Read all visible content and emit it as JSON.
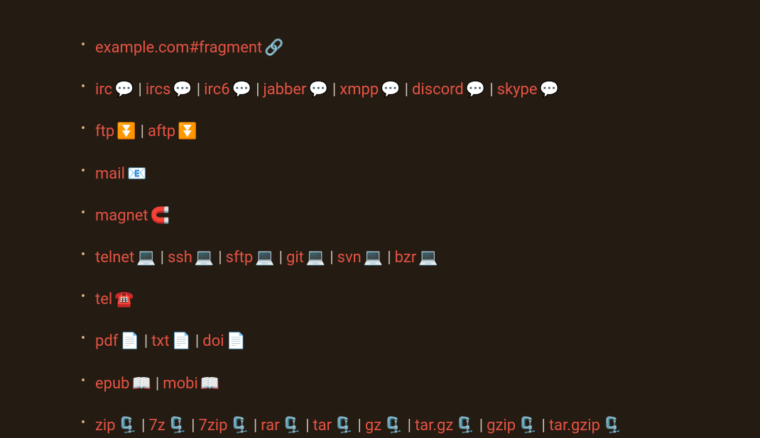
{
  "sep": "|",
  "items": [
    {
      "entries": [
        {
          "label": "example.com#fragment",
          "icon": "🔗",
          "name": "link-fragment"
        }
      ]
    },
    {
      "entries": [
        {
          "label": "irc",
          "icon": "💬",
          "name": "link-irc"
        },
        {
          "label": "ircs",
          "icon": "💬",
          "name": "link-ircs"
        },
        {
          "label": "irc6",
          "icon": "💬",
          "name": "link-irc6"
        },
        {
          "label": "jabber",
          "icon": "💬",
          "name": "link-jabber"
        },
        {
          "label": "xmpp",
          "icon": "💬",
          "name": "link-xmpp"
        },
        {
          "label": "discord",
          "icon": "💬",
          "name": "link-discord"
        },
        {
          "label": "skype",
          "icon": "💬",
          "name": "link-skype"
        }
      ]
    },
    {
      "entries": [
        {
          "label": "ftp",
          "icon": "⏬",
          "name": "link-ftp"
        },
        {
          "label": "aftp",
          "icon": "⏬",
          "name": "link-aftp"
        }
      ]
    },
    {
      "entries": [
        {
          "label": "mail",
          "icon": "📧",
          "name": "link-mail"
        }
      ]
    },
    {
      "entries": [
        {
          "label": "magnet",
          "icon": "🧲",
          "name": "link-magnet"
        }
      ]
    },
    {
      "entries": [
        {
          "label": "telnet",
          "icon": "💻",
          "name": "link-telnet"
        },
        {
          "label": "ssh",
          "icon": "💻",
          "name": "link-ssh"
        },
        {
          "label": "sftp",
          "icon": "💻",
          "name": "link-sftp"
        },
        {
          "label": "git",
          "icon": "💻",
          "name": "link-git"
        },
        {
          "label": "svn",
          "icon": "💻",
          "name": "link-svn"
        },
        {
          "label": "bzr",
          "icon": "💻",
          "name": "link-bzr"
        }
      ]
    },
    {
      "entries": [
        {
          "label": "tel",
          "icon": "☎️",
          "name": "link-tel"
        }
      ]
    },
    {
      "entries": [
        {
          "label": "pdf",
          "icon": "📄",
          "name": "link-pdf"
        },
        {
          "label": "txt",
          "icon": "📄",
          "name": "link-txt"
        },
        {
          "label": "doi",
          "icon": "📄",
          "name": "link-doi"
        }
      ]
    },
    {
      "entries": [
        {
          "label": "epub",
          "icon": "📖",
          "name": "link-epub"
        },
        {
          "label": "mobi",
          "icon": "📖",
          "name": "link-mobi"
        }
      ]
    },
    {
      "entries": [
        {
          "label": "zip",
          "icon": "🗜️",
          "name": "link-zip"
        },
        {
          "label": "7z",
          "icon": "🗜️",
          "name": "link-7z"
        },
        {
          "label": "7zip",
          "icon": "🗜️",
          "name": "link-7zip"
        },
        {
          "label": "rar",
          "icon": "🗜️",
          "name": "link-rar"
        },
        {
          "label": "tar",
          "icon": "🗜️",
          "name": "link-tar"
        },
        {
          "label": "gz",
          "icon": "🗜️",
          "name": "link-gz"
        },
        {
          "label": "tar.gz",
          "icon": "🗜️",
          "name": "link-targz"
        },
        {
          "label": "gzip",
          "icon": "🗜️",
          "name": "link-gzip"
        },
        {
          "label": "tar.gzip",
          "icon": "🗜️",
          "name": "link-targzip"
        }
      ]
    }
  ]
}
